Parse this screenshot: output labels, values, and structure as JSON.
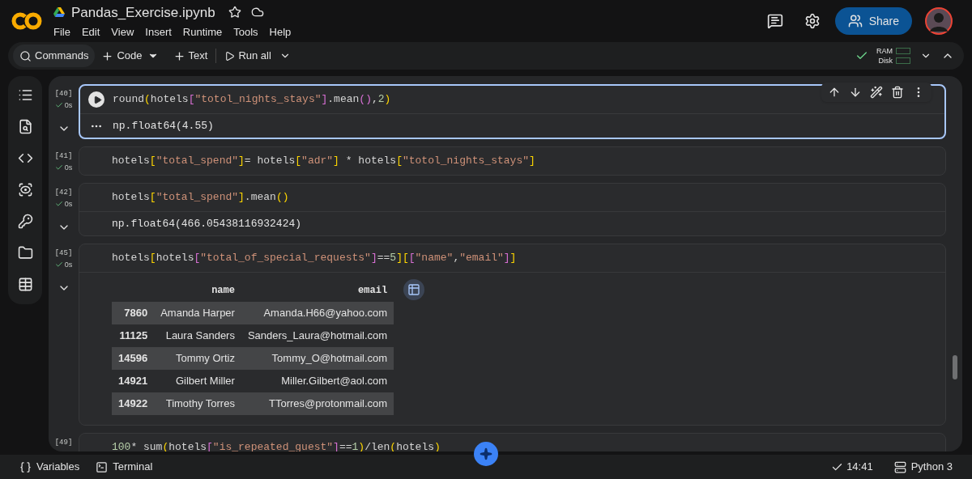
{
  "notebook": {
    "title": "Pandas_Exercise.ipynb",
    "starred": false
  },
  "menu": [
    "File",
    "Edit",
    "View",
    "Insert",
    "Runtime",
    "Tools",
    "Help"
  ],
  "toolbar": {
    "commands": "Commands",
    "add_code": "Code",
    "add_text": "Text",
    "run_all": "Run all"
  },
  "resources": {
    "ram": "RAM",
    "disk": "Disk",
    "connected": true
  },
  "share": "Share",
  "cells": [
    {
      "count": "[40]",
      "time": "0s",
      "ran": true,
      "selected": true,
      "code": "round(hotels[\"totol_nights_stays\"].mean(),2)",
      "output": {
        "kind": "text",
        "text": "np.float64(4.55)"
      }
    },
    {
      "count": "[41]",
      "time": "0s",
      "ran": true,
      "selected": false,
      "code": "hotels[\"total_spend\"]= hotels[\"adr\"] * hotels[\"totol_nights_stays\"]"
    },
    {
      "count": "[42]",
      "time": "0s",
      "ran": true,
      "selected": false,
      "code": "hotels[\"total_spend\"].mean()",
      "output": {
        "kind": "text",
        "text": "np.float64(466.05438116932424)"
      }
    },
    {
      "count": "[45]",
      "time": "0s",
      "ran": true,
      "selected": false,
      "code": "hotels[hotels[\"total_of_special_requests\"]==5][[\"name\",\"email\"]]",
      "output": {
        "kind": "table",
        "columns": [
          "name",
          "email"
        ],
        "rows": [
          {
            "index": "7860",
            "cells": [
              "Amanda Harper",
              "Amanda.H66@yahoo.com"
            ]
          },
          {
            "index": "11125",
            "cells": [
              "Laura Sanders",
              "Sanders_Laura@hotmail.com"
            ]
          },
          {
            "index": "14596",
            "cells": [
              "Tommy Ortiz",
              "Tommy_O@hotmail.com"
            ]
          },
          {
            "index": "14921",
            "cells": [
              "Gilbert Miller",
              "Miller.Gilbert@aol.com"
            ]
          },
          {
            "index": "14922",
            "cells": [
              "Timothy Torres",
              "TTorres@protonmail.com"
            ]
          }
        ]
      }
    },
    {
      "count": "[49]",
      "selected": false,
      "code": "100* sum(hotels[\"is_repeated_guest\"]==1)/len(hotels)"
    }
  ],
  "status_bar": {
    "variables": "Variables",
    "terminal": "Terminal",
    "time": "14:41",
    "runtime": "Python 3"
  }
}
